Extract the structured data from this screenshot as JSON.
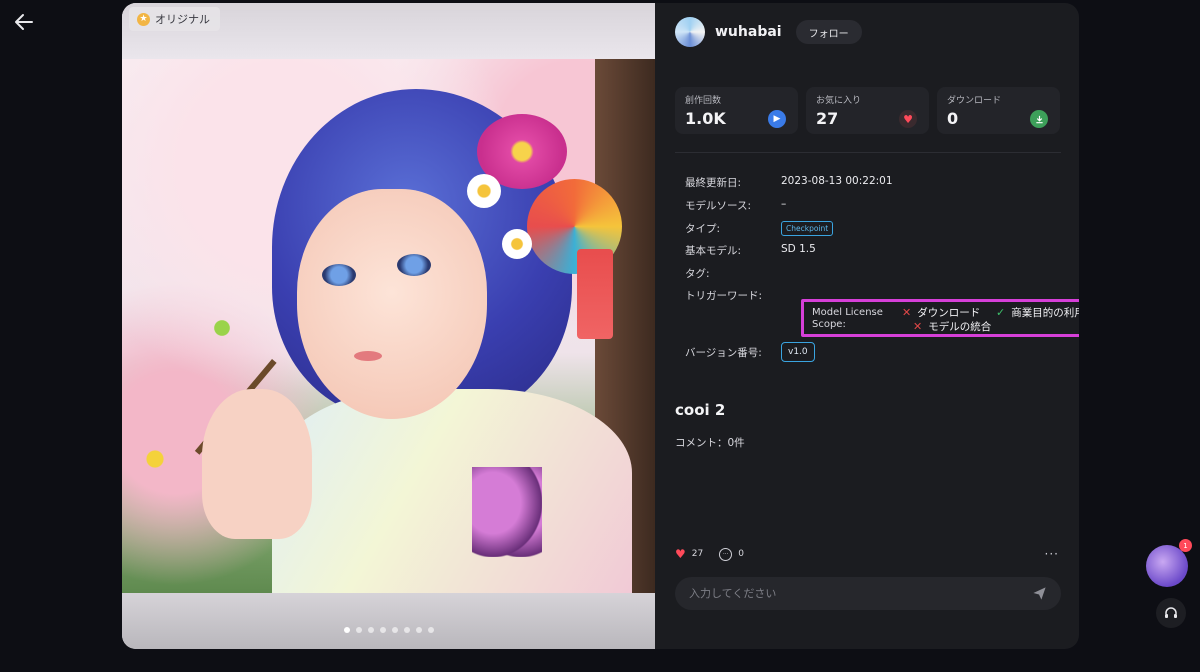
{
  "nav": {
    "back_icon": "arrow-left-icon"
  },
  "image": {
    "badge_label": "オリジナル",
    "pager": {
      "count": 8,
      "active_index": 0
    }
  },
  "author": {
    "name": "wuhabai",
    "follow_label": "フォロー"
  },
  "stats": [
    {
      "label": "創作回数",
      "value": "1.0K",
      "icon": "play-icon"
    },
    {
      "label": "お気に入り",
      "value": "27",
      "icon": "heart-icon"
    },
    {
      "label": "ダウンロード",
      "value": "0",
      "icon": "download-icon"
    }
  ],
  "details": {
    "updated_label": "最終更新日:",
    "updated_value": "2023-08-13 00:22:01",
    "source_label": "モデルソース:",
    "source_value": "–",
    "type_label": "タイプ:",
    "type_value": "Checkpoint",
    "base_label": "基本モデル:",
    "base_value": "SD 1.5",
    "tags_label": "タグ:",
    "trigger_label": "トリガーワード:",
    "license_label_1": "Model License",
    "license_label_2": "Scope:",
    "license_items": [
      {
        "label": "ダウンロード",
        "allowed": false
      },
      {
        "label": "商業目的の利用",
        "allowed": true
      },
      {
        "label": "モデルの統合",
        "allowed": false
      }
    ],
    "version_label": "バージョン番号:",
    "version_value": "v1.0"
  },
  "model_title": "cooi 2",
  "comments_label": "コメント：0件",
  "actions": {
    "likes": "27",
    "comments": "0",
    "more": "···"
  },
  "comment_input": {
    "placeholder": "入力してください",
    "value": ""
  },
  "assistant": {
    "badge": "1"
  },
  "colors": {
    "highlight": "#d63fd8",
    "accent": "#3aa4e0",
    "like": "#ff4a5a",
    "allowed": "#3dbf6a",
    "denied": "#e04848"
  }
}
